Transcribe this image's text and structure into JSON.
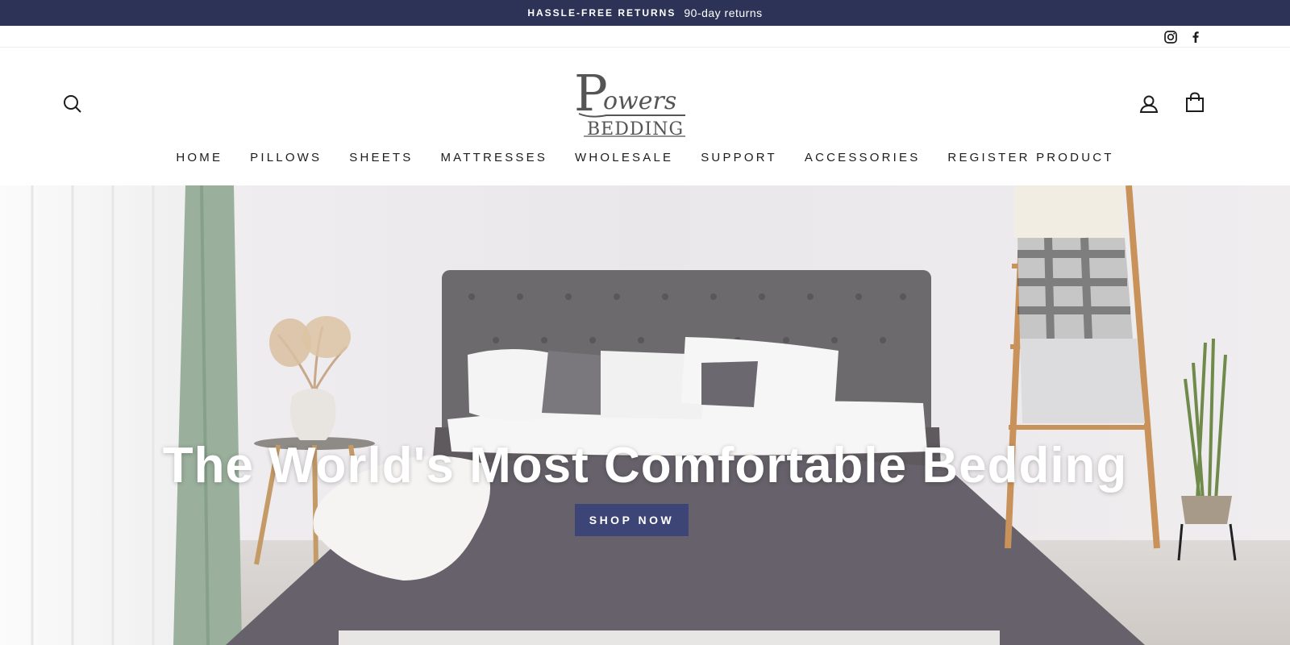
{
  "announcement": {
    "strong": "HASSLE-FREE RETURNS",
    "light": "90-day returns"
  },
  "social": {
    "instagram_icon": "instagram-icon",
    "facebook_icon": "facebook-icon"
  },
  "header": {
    "logo_top": "Powers",
    "logo_bottom": "BEDDING",
    "search_icon": "search-icon",
    "account_icon": "user-icon",
    "cart_icon": "bag-icon"
  },
  "nav": {
    "items": [
      {
        "label": "HOME"
      },
      {
        "label": "PILLOWS"
      },
      {
        "label": "SHEETS"
      },
      {
        "label": "MATTRESSES"
      },
      {
        "label": "WHOLESALE"
      },
      {
        "label": "SUPPORT"
      },
      {
        "label": "ACCESSORIES"
      },
      {
        "label": "REGISTER PRODUCT"
      }
    ]
  },
  "hero": {
    "title": "The World's Most Comfortable Bedding",
    "button_label": "SHOP NOW"
  },
  "colors": {
    "announcement_bg": "#2d3356",
    "button_bg": "#3d4476",
    "text": "#1c1c1c"
  }
}
